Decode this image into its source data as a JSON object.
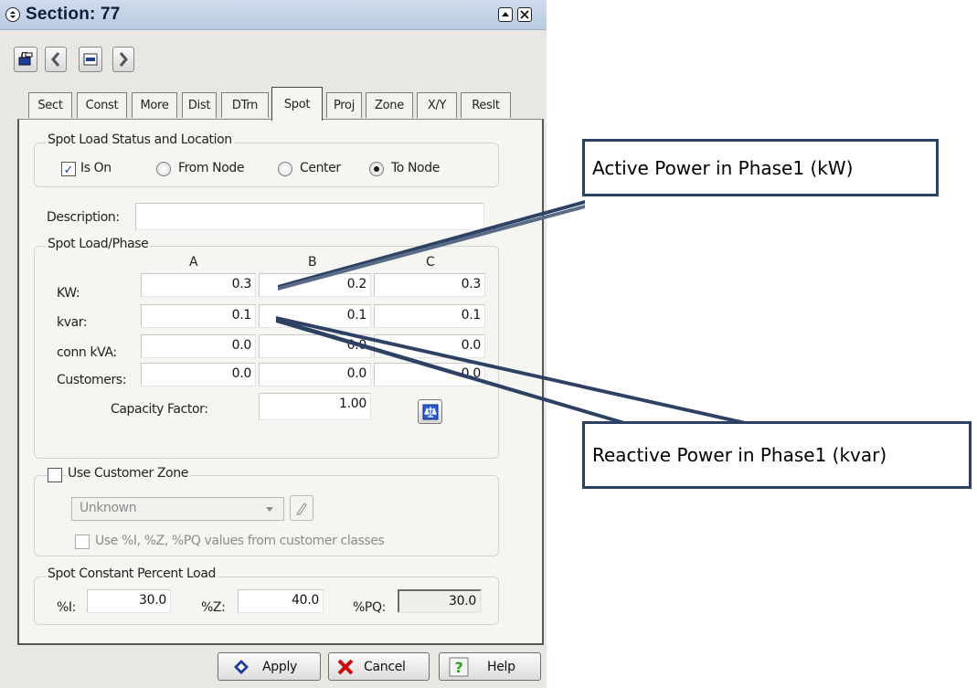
{
  "window": {
    "title": "Section: 77"
  },
  "tabs": [
    {
      "label": "Sect"
    },
    {
      "label": "Const"
    },
    {
      "label": "More"
    },
    {
      "label": "Dist"
    },
    {
      "label": "DTrn"
    },
    {
      "label": "Spot"
    },
    {
      "label": "Proj"
    },
    {
      "label": "Zone"
    },
    {
      "label": "X/Y"
    },
    {
      "label": "Reslt"
    }
  ],
  "active_tab": "Spot",
  "status_group": {
    "legend": "Spot Load Status and Location",
    "is_on_label": "Is On",
    "is_on_checked": true,
    "radios": [
      {
        "label": "From Node",
        "selected": false
      },
      {
        "label": "Center",
        "selected": false
      },
      {
        "label": "To Node",
        "selected": true
      }
    ]
  },
  "description": {
    "label": "Description:",
    "value": ""
  },
  "load_phase": {
    "legend": "Spot Load/Phase",
    "columns": [
      "A",
      "B",
      "C"
    ],
    "rows": [
      {
        "label": "KW:",
        "values": [
          "0.3",
          "0.2",
          "0.3"
        ]
      },
      {
        "label": "kvar:",
        "values": [
          "0.1",
          "0.1",
          "0.1"
        ]
      },
      {
        "label": "conn kVA:",
        "values": [
          "0.0",
          "0.0",
          "0.0"
        ]
      },
      {
        "label": "Customers:",
        "values": [
          "0.0",
          "0.0",
          "0.0"
        ]
      }
    ],
    "capacity_factor_label": "Capacity Factor:",
    "capacity_factor_value": "1.00"
  },
  "customer_zone": {
    "label": "Use Customer Zone",
    "checked": false,
    "dropdown_value": "Unknown",
    "use_classes_label": "Use %I, %Z, %PQ values from customer classes",
    "use_classes_checked": false
  },
  "constant_percent": {
    "legend": "Spot Constant Percent Load",
    "i_label": "%I:",
    "i_value": "30.0",
    "z_label": "%Z:",
    "z_value": "40.0",
    "pq_label": "%PQ:",
    "pq_value": "30.0"
  },
  "buttons": {
    "apply": "Apply",
    "cancel": "Cancel",
    "help": "Help"
  },
  "callouts": {
    "active": "Active Power in Phase1 (kW)",
    "reactive": "Reactive Power in Phase1 (kvar)"
  },
  "colors": {
    "callout_border": "#2e4164",
    "titlebar": "#c6d6ea"
  }
}
